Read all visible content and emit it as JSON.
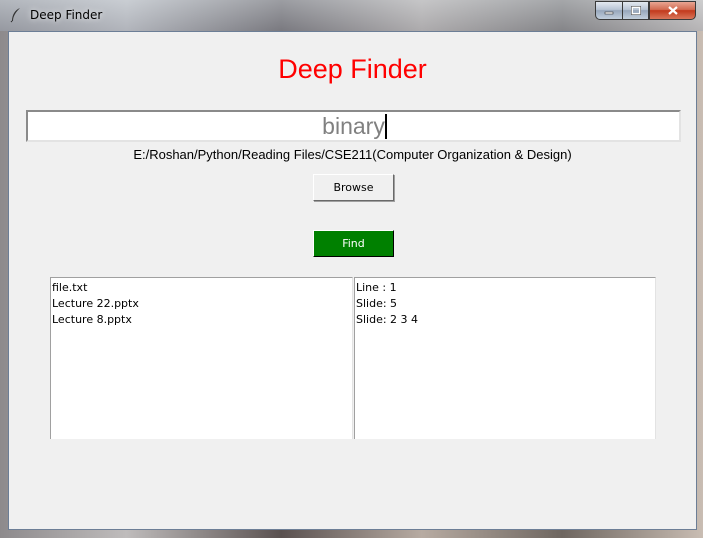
{
  "window": {
    "title": "Deep Finder",
    "icon": "feather-icon"
  },
  "caption_buttons": {
    "minimize_icon": "minimize-icon",
    "maximize_icon": "maximize-icon",
    "close_icon": "close-icon"
  },
  "main": {
    "heading": "Deep Finder",
    "heading_color": "#ff0000",
    "search": {
      "value": "binary",
      "placeholder": ""
    },
    "path": "E:/Roshan/Python/Reading Files/CSE211(Computer Organization & Design)",
    "browse_label": "Browse",
    "find_label": "Find",
    "find_color": "#008000"
  },
  "results": {
    "files": [
      "file.txt",
      "Lecture 22.pptx",
      "Lecture 8.pptx"
    ],
    "locations": [
      "Line : 1",
      "Slide: 5",
      "Slide: 2 3 4"
    ]
  }
}
